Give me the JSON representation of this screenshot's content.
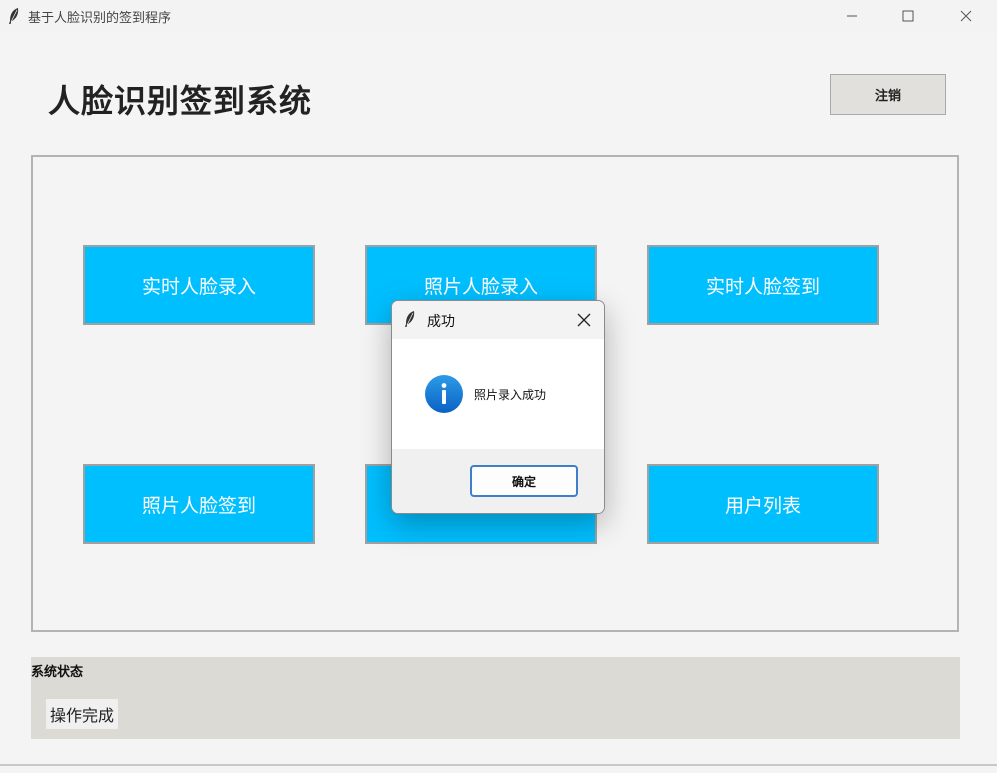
{
  "window": {
    "title": "基于人脸识别的签到程序"
  },
  "header": {
    "title": "人脸识别签到系统",
    "logout_label": "注销"
  },
  "actions": [
    {
      "label": "实时人脸录入"
    },
    {
      "label": "照片人脸录入"
    },
    {
      "label": "实时人脸签到"
    },
    {
      "label": "照片人脸签到"
    },
    {
      "label": ""
    },
    {
      "label": "用户列表"
    }
  ],
  "status": {
    "title": "系统状态",
    "text": "操作完成"
  },
  "dialog": {
    "title": "成功",
    "message": "照片录入成功",
    "ok_label": "确定"
  },
  "colors": {
    "action_button": "#00bfff",
    "status_bg": "#dcdad5",
    "dialog_accent": "#3f7fc9"
  }
}
